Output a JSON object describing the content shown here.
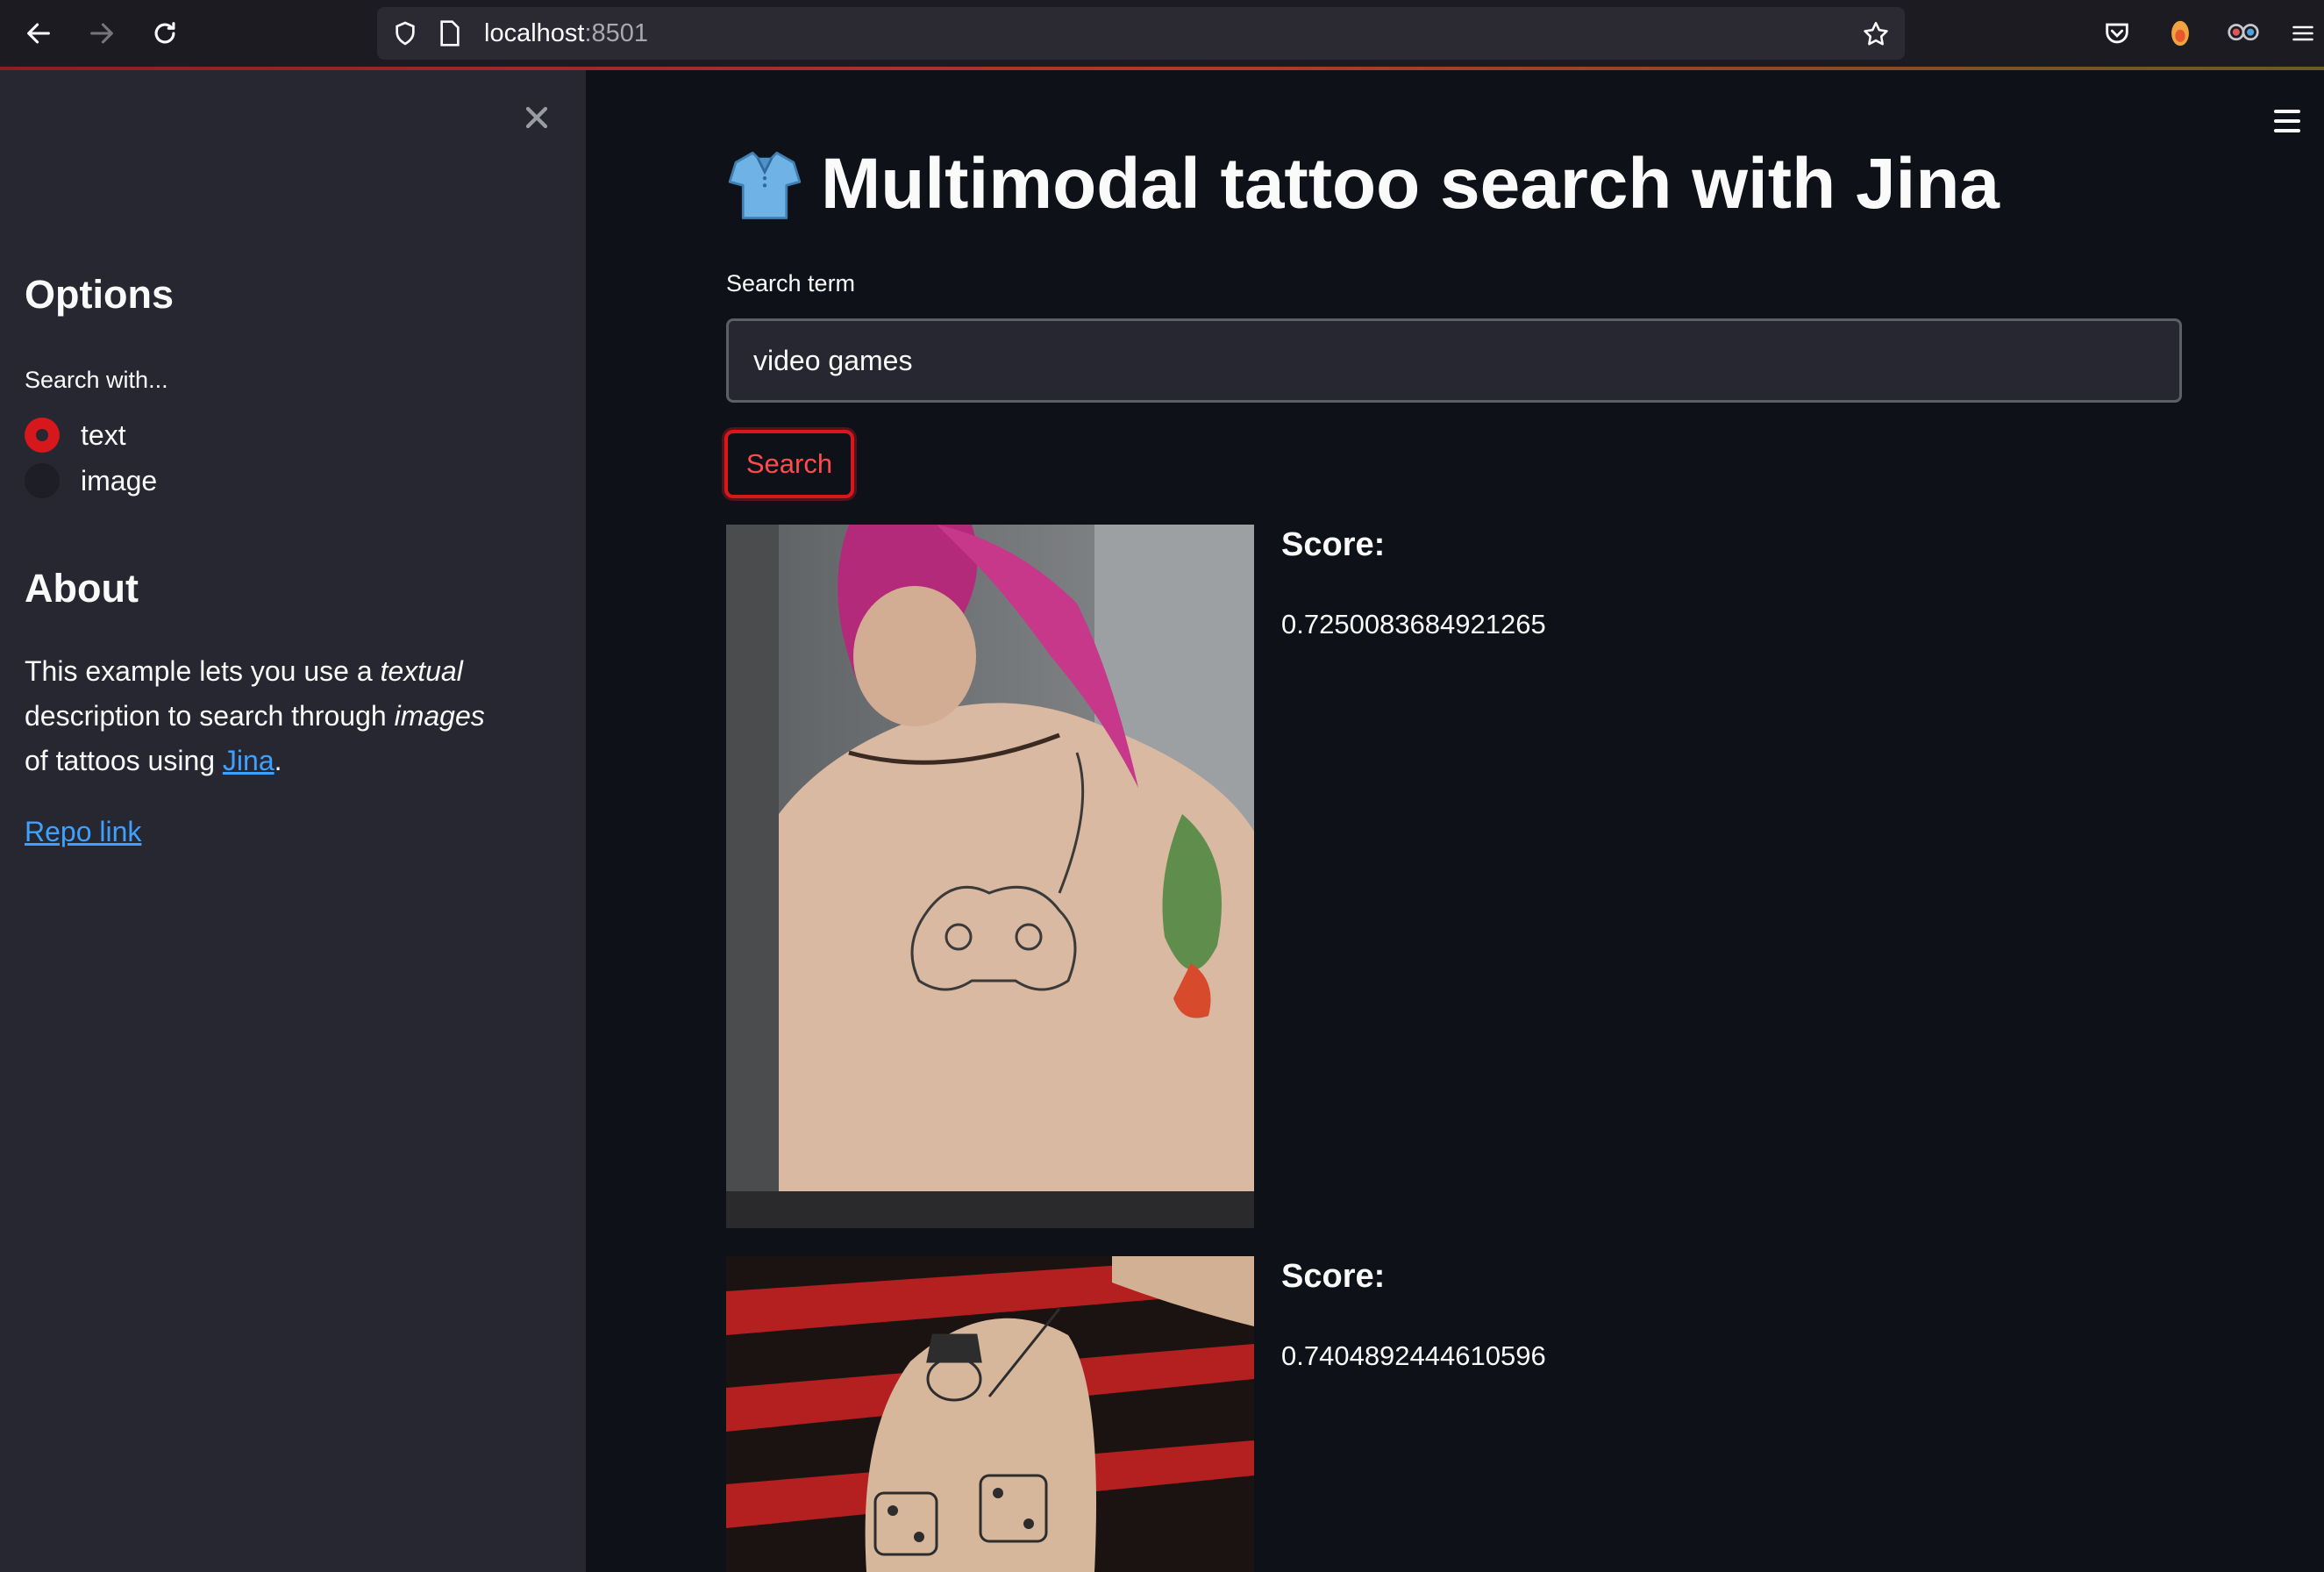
{
  "browser": {
    "url_host": "localhost",
    "url_port": ":8501"
  },
  "sidebar": {
    "options_heading": "Options",
    "search_with_label": "Search with...",
    "radio_options": [
      {
        "label": "text",
        "selected": true
      },
      {
        "label": "image",
        "selected": false
      }
    ],
    "about_heading": "About",
    "about": {
      "t1": "This example lets you use a ",
      "em1": "textual",
      "t2": " description to search through ",
      "em2": "images",
      "t3": " of tattoos using ",
      "link": "Jina",
      "t4": "."
    },
    "repo_link": "Repo link"
  },
  "main": {
    "title_icon": "shirt-icon",
    "title": "Multimodal tattoo search with Jina",
    "search_label": "Search term",
    "search_value": "video games",
    "search_button": "Search",
    "results": [
      {
        "score_label": "Score:",
        "score": "0.7250083684921265",
        "image": "back-tattoo-game-controller"
      },
      {
        "score_label": "Score:",
        "score": "0.7404892444610596",
        "image": "arm-tattoo-monopoly-man-dice"
      }
    ]
  },
  "colors": {
    "background": "#0e1117",
    "sidebar": "#262730",
    "primary": "#d6171c",
    "link": "#3ea1ff"
  }
}
